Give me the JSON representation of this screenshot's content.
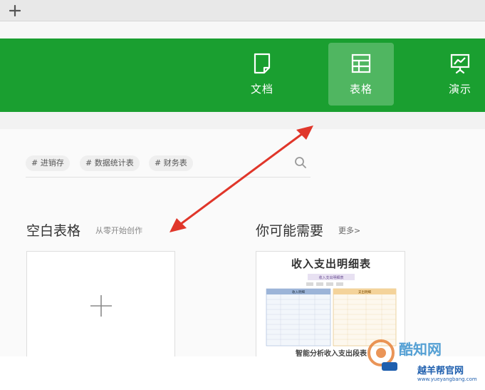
{
  "toolbar": {
    "new_tab_icon": "plus-icon"
  },
  "header": {
    "bg_color": "#1a9f30",
    "categories": [
      {
        "label": "文档",
        "icon": "document-icon",
        "active": false
      },
      {
        "label": "表格",
        "icon": "table-icon",
        "active": true
      },
      {
        "label": "演示",
        "icon": "presentation-icon",
        "active": false
      }
    ]
  },
  "search": {
    "tags": [
      "# 进销存",
      "# 数据统计表",
      "# 财务表"
    ],
    "icon": "search-icon"
  },
  "blank_section": {
    "title": "空白表格",
    "subtitle": "从零开始创作"
  },
  "suggest_section": {
    "title": "你可能需要",
    "more_link": "更多>",
    "template": {
      "title": "收入支出明细表",
      "subtitle": "收入支出明细表",
      "left_header": "收入明细",
      "right_header": "支出明细",
      "footer": "智能分析收入支出段表"
    }
  },
  "watermark": {
    "name": "酷知网",
    "name2": "越羊帮官网",
    "url": "www.yueyangbang.com"
  }
}
